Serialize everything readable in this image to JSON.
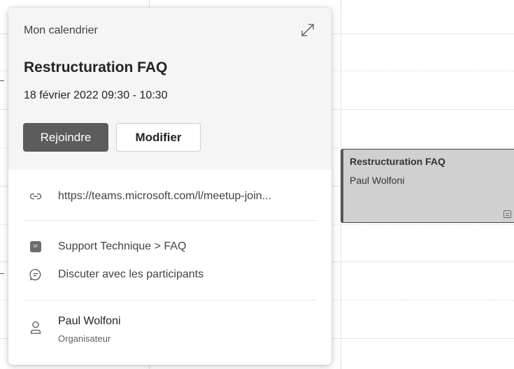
{
  "popup": {
    "calendar_name": "Mon calendrier",
    "title": "Restructuration FAQ",
    "datetime": "18 février 2022 09:30 - 10:30",
    "join_label": "Rejoindre",
    "edit_label": "Modifier",
    "meeting_link": "https://teams.microsoft.com/l/meetup-join...",
    "channel": "Support Technique > FAQ",
    "channel_badge": "ST",
    "chat_label": "Discuter avec les participants",
    "organizer_name": "Paul Wolfoni",
    "organizer_role": "Organisateur"
  },
  "calendar_event": {
    "title": "Restructuration FAQ",
    "organizer": "Paul Wolfoni"
  },
  "icons": {
    "expand": "expand-icon",
    "link": "link-icon",
    "chat": "chat-icon",
    "person": "person-icon",
    "notes": "notes-icon"
  }
}
